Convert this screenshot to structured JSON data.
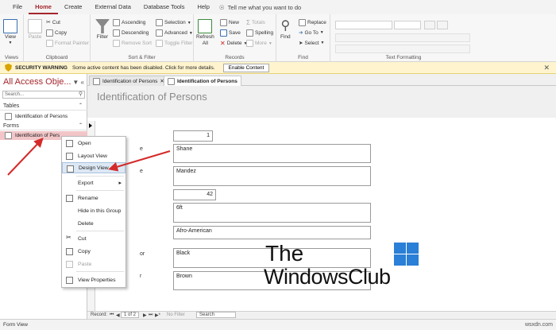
{
  "ribbon_tabs": {
    "file": "File",
    "home": "Home",
    "create": "Create",
    "external": "External Data",
    "dbtools": "Database Tools",
    "help": "Help",
    "tellme": "Tell me what you want to do"
  },
  "ribbon": {
    "views": {
      "view": "View",
      "group": "Views"
    },
    "clipboard": {
      "paste": "Paste",
      "cut": "Cut",
      "copy": "Copy",
      "format_painter": "Format Painter",
      "group": "Clipboard"
    },
    "sort_filter": {
      "filter": "Filter",
      "ascending": "Ascending",
      "descending": "Descending",
      "remove_sort": "Remove Sort",
      "selection": "Selection",
      "advanced": "Advanced",
      "toggle_filter": "Toggle Filter",
      "group": "Sort & Filter"
    },
    "records": {
      "refresh": "Refresh",
      "refresh_all": "All",
      "new": "New",
      "save": "Save",
      "delete": "Delete",
      "totals": "Totals",
      "spelling": "Spelling",
      "more": "More",
      "group": "Records"
    },
    "find": {
      "find": "Find",
      "replace": "Replace",
      "goto": "Go To",
      "select": "Select",
      "group": "Find"
    },
    "text_formatting": {
      "group": "Text Formatting"
    }
  },
  "security": {
    "label": "SECURITY WARNING",
    "message": "Some active content has been disabled. Click for more details.",
    "button": "Enable Content"
  },
  "nav": {
    "title": "All Access Obje...",
    "search_placeholder": "Search...",
    "tables_label": "Tables",
    "table_item": "Identification of Persons",
    "forms_label": "Forms",
    "form_item": "Identification of Pers"
  },
  "doc_tabs": {
    "tab1": "Identification of Persons",
    "tab2": "Identification of Persons"
  },
  "form": {
    "title": "Identification of Persons",
    "labels": {
      "l1": "e",
      "l2": "e",
      "l3": "or",
      "l4": "r"
    },
    "fields": {
      "id": "1",
      "first": "Shane",
      "last": "Mandez",
      "age": "42",
      "height": "6ft",
      "race": "Afro-American",
      "hair": "Black",
      "eyes": "Brown"
    }
  },
  "context_menu": {
    "open": "Open",
    "layout_view": "Layout View",
    "design_view": "Design View",
    "export": "Export",
    "rename": "Rename",
    "hide": "Hide in this Group",
    "delete": "Delete",
    "cut": "Cut",
    "copy": "Copy",
    "paste": "Paste",
    "properties": "View Properties"
  },
  "record_nav": {
    "record": "Record:",
    "position": "1 of 2",
    "nofilter": "No Filter",
    "search": "Search"
  },
  "status": {
    "text": "Form View",
    "watermark": "wsxdn.com"
  },
  "logo": {
    "line1": "The",
    "line2": "WindowsClub"
  },
  "colors": {
    "access_accent": "#a4262c",
    "warning_bar": "#fff4ce",
    "arrow": "#d42a2a",
    "selected_item": "#f2c6c8"
  }
}
